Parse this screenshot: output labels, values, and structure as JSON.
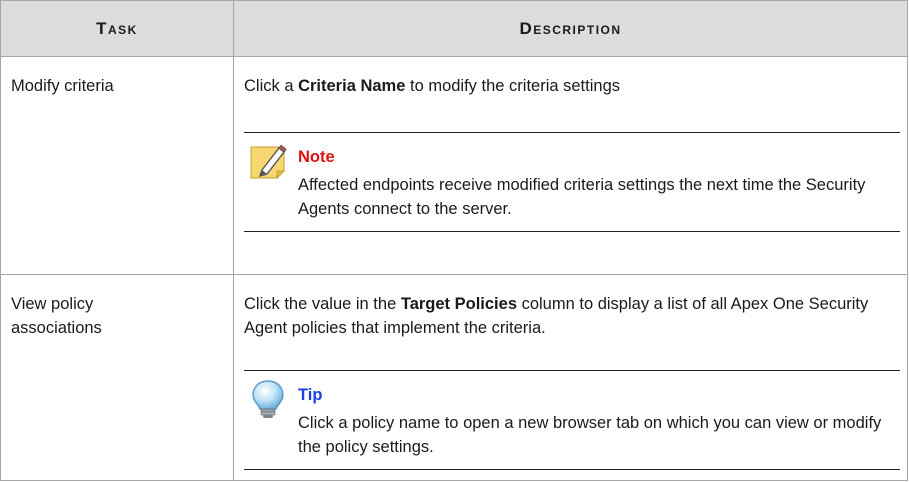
{
  "header": {
    "task": "Task",
    "description": "Description"
  },
  "rows": [
    {
      "task": "Modify criteria",
      "desc_pre": "Click a ",
      "desc_bold": "Criteria Name",
      "desc_post": " to modify the criteria settings",
      "callout": {
        "title": "Note",
        "icon": "note-pencil-icon",
        "body": "Affected endpoints receive modified criteria settings the next time the Security Agents connect to the server."
      }
    },
    {
      "task": "View policy associations",
      "desc_pre": "Click the value in the ",
      "desc_bold": "Target Policies",
      "desc_post": " column to display a list of all Apex One Security Agent policies that implement the criteria.",
      "callout": {
        "title": "Tip",
        "icon": "lightbulb-icon",
        "body": "Click a policy name to open a new browser tab on which you can view or modify the policy settings."
      }
    }
  ],
  "colors": {
    "header_bg": "#dcdcdc",
    "note_title": "#e01010",
    "tip_title": "#1a3ee0"
  }
}
